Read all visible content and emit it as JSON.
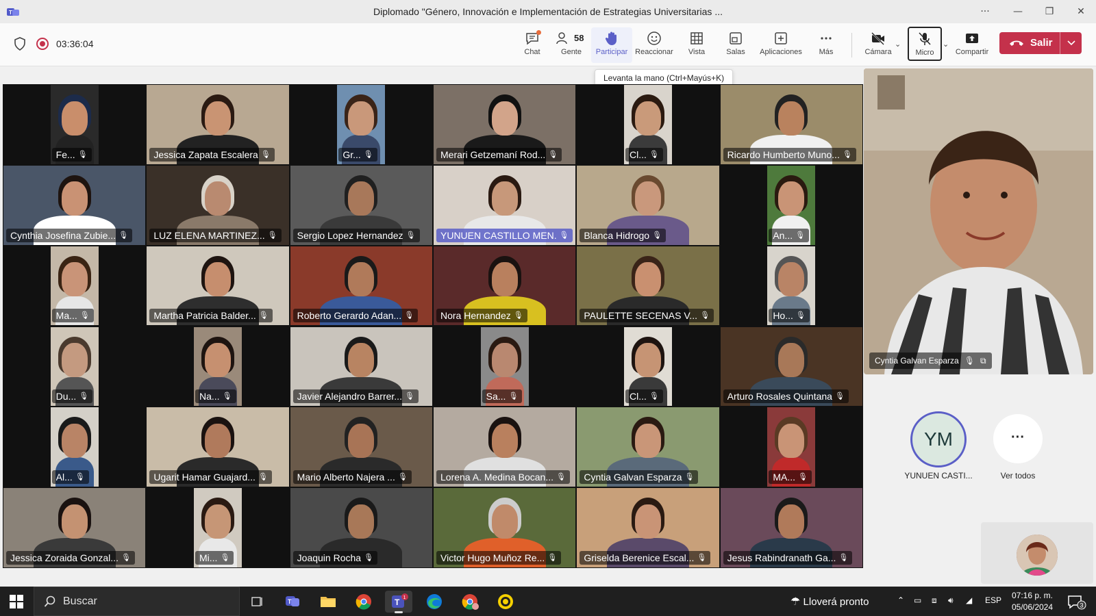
{
  "window": {
    "title": "Diplomado \"Género, Innovación e Implementación de Estrategias Universitarias ...",
    "controls": [
      "···",
      "—",
      "❐",
      "✕"
    ]
  },
  "toolbar": {
    "timer": "03:36:04",
    "people_count": "58",
    "buttons": {
      "chat": "Chat",
      "people": "Gente",
      "raise": "Participar",
      "react": "Reaccionar",
      "view": "Vista",
      "rooms": "Salas",
      "apps": "Aplicaciones",
      "more": "Más",
      "camera": "Cámara",
      "mic": "Micro",
      "share": "Compartir"
    },
    "leave_label": "Salir",
    "accent": "#5b5fc7",
    "leave_color": "#c4314b"
  },
  "tooltip": "Levanta la mano (Ctrl+Mayús+K)",
  "participants": [
    {
      "name": "Fe...",
      "bg": "#2a2a2a",
      "skin": "#c98e6b",
      "hair": "#1c2b4a",
      "cloth": "#222222",
      "narrow": true
    },
    {
      "name": "Jessica Zapata Escalera",
      "bg": "#b8a892",
      "skin": "#c99473",
      "hair": "#2a1a12",
      "cloth": "#222222",
      "narrow": false
    },
    {
      "name": "Gr...",
      "bg": "#6f8fb0",
      "skin": "#c9987a",
      "hair": "#3a2418",
      "cloth": "#3a4a6a",
      "narrow": true
    },
    {
      "name": "Merari Getzemaní Rod...",
      "bg": "#7c7066",
      "skin": "#d2a48a",
      "hair": "#111111",
      "cloth": "#1a1a1a",
      "narrow": false
    },
    {
      "name": "Cl...",
      "bg": "#d9d4cc",
      "skin": "#c99a7a",
      "hair": "#2b1a10",
      "cloth": "#3b3b3b",
      "narrow": true
    },
    {
      "name": "Ricardo Humberto Muno...",
      "bg": "#9b8c6a",
      "skin": "#b9825e",
      "hair": "#222222",
      "cloth": "#f0f0f0",
      "narrow": false
    },
    {
      "name": "Cynthia Josefina Zubie...",
      "bg": "#4a5668",
      "skin": "#c99274",
      "hair": "#1e1410",
      "cloth": "#ffffff",
      "narrow": false
    },
    {
      "name": "LUZ ELENA MARTINEZ...",
      "bg": "#3a3028",
      "skin": "#b98a70",
      "hair": "#d8d2c8",
      "cloth": "#8a7a6a",
      "narrow": false
    },
    {
      "name": "Sergio Lopez Hernandez",
      "bg": "#5a5a5a",
      "skin": "#a8785a",
      "hair": "#202020",
      "cloth": "#3a3a3a",
      "narrow": false
    },
    {
      "name": "YUNUEN CASTILLO MEN...",
      "bg": "#d8d0c8",
      "skin": "#c7987a",
      "hair": "#2a1a12",
      "cloth": "#e8e8e8",
      "narrow": false,
      "speaking": true
    },
    {
      "name": "Blanca Hidrogo",
      "bg": "#b8a88c",
      "skin": "#c9987c",
      "hair": "#6a4a30",
      "cloth": "#6a5a8a",
      "narrow": false
    },
    {
      "name": "An...",
      "bg": "#4e7a3c",
      "skin": "#c99476",
      "hair": "#2a1a10",
      "cloth": "#f0f0f0",
      "narrow": true
    },
    {
      "name": "Ma...",
      "bg": "#c4b8a8",
      "skin": "#c99478",
      "hair": "#3a2414",
      "cloth": "#e6e6e6",
      "narrow": true
    },
    {
      "name": "Martha Patricia Balder...",
      "bg": "#cfc8bc",
      "skin": "#c68e6e",
      "hair": "#1e1410",
      "cloth": "#2e2e2e",
      "narrow": false
    },
    {
      "name": "Roberto Gerardo Adan...",
      "bg": "#8a3a2a",
      "skin": "#b07a5a",
      "hair": "#1a1a1a",
      "cloth": "#3a5a9a",
      "narrow": false
    },
    {
      "name": "Nora Hernandez",
      "bg": "#5a2a2a",
      "skin": "#b9805e",
      "hair": "#1a1210",
      "cloth": "#d8c020",
      "narrow": false
    },
    {
      "name": "PAULETTE SECENAS V...",
      "bg": "#7a7048",
      "skin": "#c99070",
      "hair": "#3a2418",
      "cloth": "#2a2a2a",
      "narrow": false
    },
    {
      "name": "Ho...",
      "bg": "#d8d4cc",
      "skin": "#b98466",
      "hair": "#555555",
      "cloth": "#6a7a8a",
      "narrow": true
    },
    {
      "name": "Du...",
      "bg": "#cfc6b8",
      "skin": "#c49a80",
      "hair": "#4a3a2e",
      "cloth": "#555555",
      "narrow": true
    },
    {
      "name": "Na...",
      "bg": "#9a8a7a",
      "skin": "#c69070",
      "hair": "#1e1410",
      "cloth": "#4a4a5a",
      "narrow": true
    },
    {
      "name": "Javier Alejandro Barrer...",
      "bg": "#c9c4bc",
      "skin": "#b88462",
      "hair": "#1a1a1a",
      "cloth": "#3a3a3a",
      "narrow": false
    },
    {
      "name": "Sa...",
      "bg": "#8a8a8a",
      "skin": "#b98870",
      "hair": "#2a1a12",
      "cloth": "#c06a5a",
      "narrow": true
    },
    {
      "name": "Cl...",
      "bg": "#e0dcd4",
      "skin": "#c69474",
      "hair": "#1e1410",
      "cloth": "#3a3a3a",
      "narrow": true
    },
    {
      "name": "Arturo Rosales Quintana",
      "bg": "#4a3424",
      "skin": "#a87858",
      "hair": "#2a2a2a",
      "cloth": "#3a4a5a",
      "narrow": false
    },
    {
      "name": "Al...",
      "bg": "#d4d0c8",
      "skin": "#b98466",
      "hair": "#1a1a1a",
      "cloth": "#3a5a8a",
      "narrow": true
    },
    {
      "name": "Ugarit Hamar Guajard...",
      "bg": "#c9bca8",
      "skin": "#b07a5c",
      "hair": "#1a1210",
      "cloth": "#2a2a2a",
      "narrow": false
    },
    {
      "name": "Mario Alberto Najera ...",
      "bg": "#6a5a4a",
      "skin": "#a87456",
      "hair": "#222222",
      "cloth": "#2a2a2a",
      "narrow": false
    },
    {
      "name": "Lorena A. Medina Bocan...",
      "bg": "#b4aaa0",
      "skin": "#b9805e",
      "hair": "#1a1210",
      "cloth": "#e0e0e0",
      "narrow": false
    },
    {
      "name": "Cyntia Galvan Esparza",
      "bg": "#8a9a70",
      "skin": "#c99678",
      "hair": "#2a1a12",
      "cloth": "#5a6a7a",
      "narrow": false
    },
    {
      "name": "MA...",
      "bg": "#8a3a3a",
      "skin": "#c99476",
      "hair": "#5a3a24",
      "cloth": "#c02a2a",
      "narrow": true
    },
    {
      "name": "Jessica Zoraida Gonzal...",
      "bg": "#8a8278",
      "skin": "#c49272",
      "hair": "#1a1210",
      "cloth": "#3a3a3a",
      "narrow": false
    },
    {
      "name": "Mi...",
      "bg": "#d0cac0",
      "skin": "#c69676",
      "hair": "#2a1a12",
      "cloth": "#e8e8e8",
      "narrow": true
    },
    {
      "name": "Joaquin Rocha",
      "bg": "#4a4a4a",
      "skin": "#a87858",
      "hair": "#1a1a1a",
      "cloth": "#2a2a2a",
      "narrow": false
    },
    {
      "name": "Victor Hugo Muñoz Re...",
      "bg": "#5a6a3a",
      "skin": "#c08a6a",
      "hair": "#cccccc",
      "cloth": "#e0602a",
      "narrow": false
    },
    {
      "name": "Griselda Berenice Escal...",
      "bg": "#c8a07a",
      "skin": "#c99476",
      "hair": "#2a1a12",
      "cloth": "#5a4a6a",
      "narrow": false
    },
    {
      "name": "Jesus Rabindranath Ga...",
      "bg": "#6a4a5a",
      "skin": "#b07a5a",
      "hair": "#1a1a1a",
      "cloth": "#2a3a4a",
      "narrow": false
    }
  ],
  "spotlight": {
    "name": "Cyntia Galvan Esparza"
  },
  "roster": {
    "avatar_initials": "YM",
    "avatar_name": "YUNUEN CASTI...",
    "more_glyph": "···",
    "see_all": "Ver todos"
  },
  "taskbar": {
    "search_placeholder": "Buscar",
    "weather": "Lloverá pronto",
    "language": "ESP",
    "time": "07:16 p. m.",
    "date": "05/06/2024",
    "notifications": "3"
  }
}
